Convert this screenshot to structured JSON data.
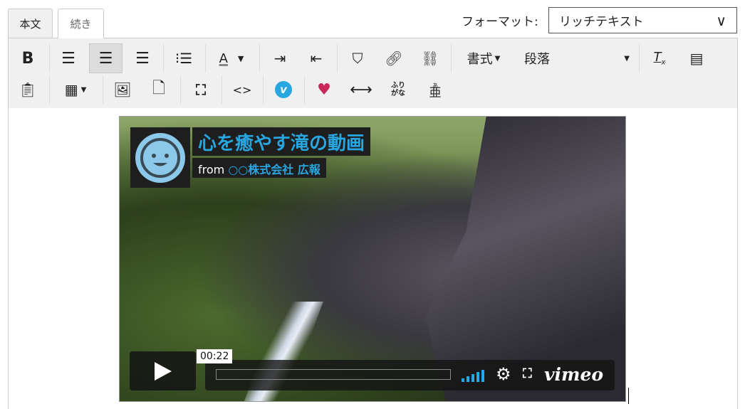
{
  "tabs": [
    {
      "label": "本文"
    },
    {
      "label": "続き"
    }
  ],
  "format": {
    "label": "フォーマット:",
    "value": "リッチテキスト"
  },
  "toolbar": {
    "styles_label": "書式",
    "paragraph_label": "段落",
    "furigana_label_top": "ふり",
    "furigana_label_bottom": "がな",
    "ruby_top": "あ",
    "ruby_base": "亜",
    "bold": "B",
    "font_color": "A",
    "tx": "T"
  },
  "video": {
    "title": "心を癒やす滝の動画",
    "from_prefix": "from",
    "from_org": "○○株式会社 広報",
    "time": "00:22",
    "brand": "vimeo",
    "progress": 0.0,
    "accent": "#27a6e0"
  }
}
